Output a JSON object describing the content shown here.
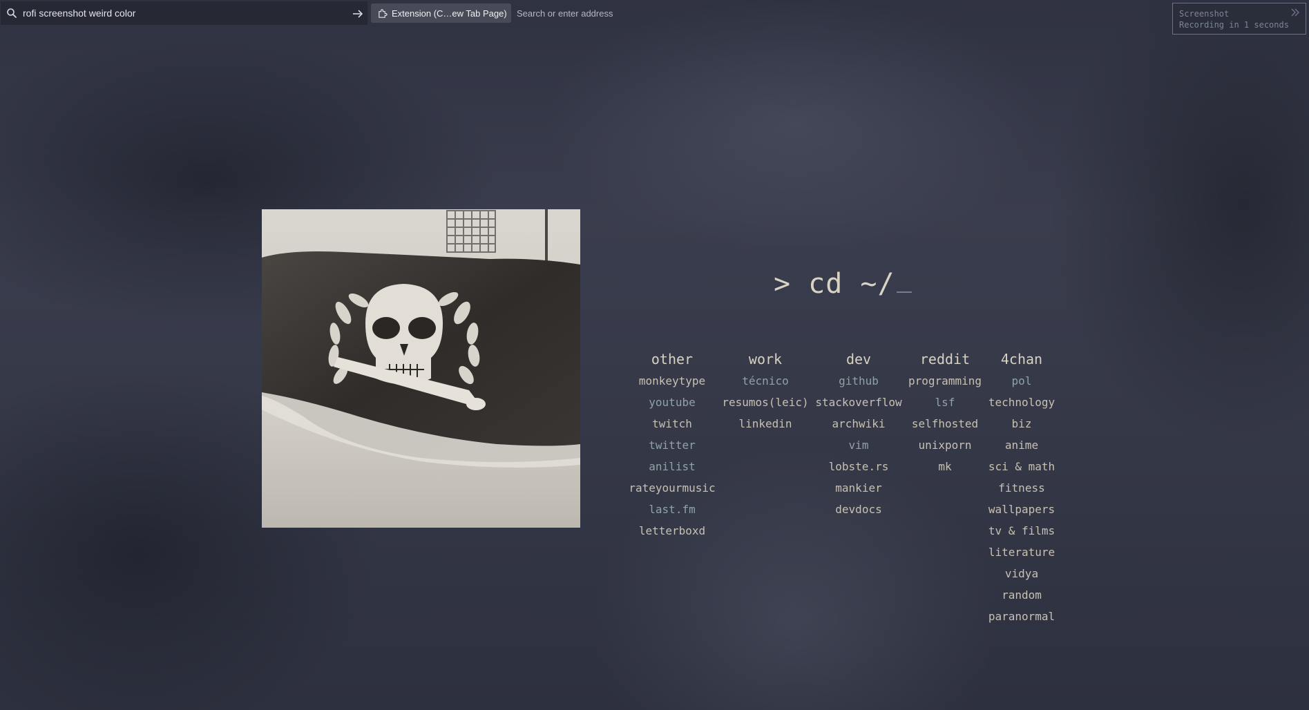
{
  "launcher": {
    "icon": "search-icon",
    "query": "rofi screenshot weird color",
    "go_icon": "arrow-right-icon"
  },
  "tab": {
    "icon": "puzzle-piece-icon",
    "label": "Extension (C…ew Tab Page)"
  },
  "address": {
    "placeholder": "Search or enter address"
  },
  "screenshot_popup": {
    "title": "Screenshot",
    "subtitle": "Recording in 1 seconds",
    "icon": "double-chevron-right-icon"
  },
  "prompt": {
    "text": "> cd ~/"
  },
  "image": {
    "description_icon": "skull-flag-photo"
  },
  "columns": [
    {
      "heading": "other",
      "links": [
        "monkeytype",
        "youtube",
        "twitch",
        "twitter",
        "anilist",
        "rateyourmusic",
        "last.fm",
        "letterboxd"
      ]
    },
    {
      "heading": "work",
      "links": [
        "técnico",
        "resumos(leic)",
        "linkedin"
      ]
    },
    {
      "heading": "dev",
      "links": [
        "github",
        "stackoverflow",
        "archwiki",
        "vim",
        "lobste.rs",
        "mankier",
        "devdocs"
      ]
    },
    {
      "heading": "reddit",
      "links": [
        "programming",
        "lsf",
        "selfhosted",
        "unixporn",
        "mk"
      ]
    },
    {
      "heading": "4chan",
      "links": [
        "pol",
        "technology",
        "biz",
        "anime",
        "sci & math",
        "fitness",
        "wallpapers",
        "tv & films",
        "literature",
        "vidya",
        "random",
        "paranormal"
      ]
    }
  ],
  "colors": {
    "background": "#353847",
    "text": "#c7c1b3",
    "link_alt": "#8fa3a6",
    "heading": "#d8d2c4"
  }
}
